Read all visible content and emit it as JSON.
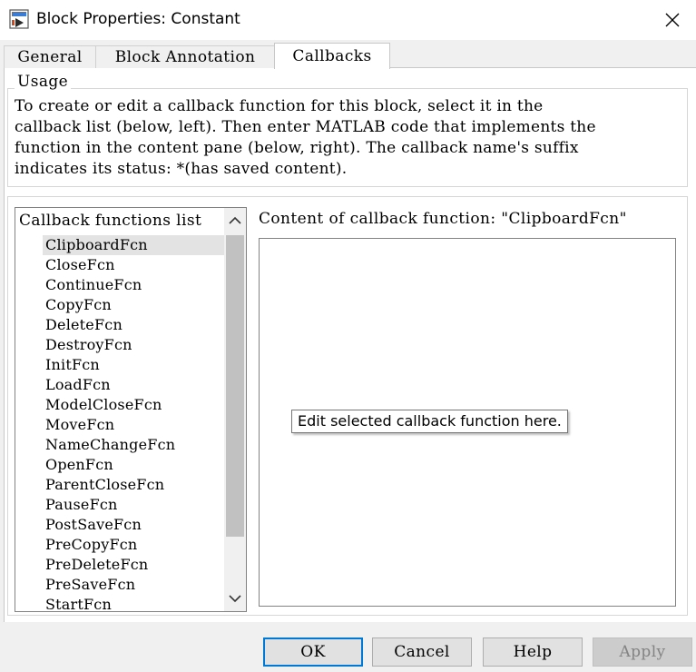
{
  "window": {
    "title": "Block Properties: Constant",
    "icon": "simulink-block-icon",
    "close_icon": "close-icon"
  },
  "tabs": [
    {
      "label": "General",
      "active": false
    },
    {
      "label": "Block Annotation",
      "active": false
    },
    {
      "label": "Callbacks",
      "active": true
    }
  ],
  "usage": {
    "legend": "Usage",
    "text": "To create or edit a callback function for this block, select it in the\ncallback list (below, left). Then enter MATLAB code that implements the\nfunction in the content pane (below, right). The callback name's suffix\nindicates its status: *(has saved content)."
  },
  "callbacks": {
    "header": "Callback functions list",
    "selected": "ClipboardFcn",
    "items": [
      "ClipboardFcn",
      "CloseFcn",
      "ContinueFcn",
      "CopyFcn",
      "DeleteFcn",
      "DestroyFcn",
      "InitFcn",
      "LoadFcn",
      "ModelCloseFcn",
      "MoveFcn",
      "NameChangeFcn",
      "OpenFcn",
      "ParentCloseFcn",
      "PauseFcn",
      "PostSaveFcn",
      "PreCopyFcn",
      "PreDeleteFcn",
      "PreSaveFcn",
      "StartFcn"
    ]
  },
  "content": {
    "label": "Content of callback function: \"ClipboardFcn\"",
    "tooltip": "Edit selected callback function here."
  },
  "buttons": {
    "ok": "OK",
    "cancel": "Cancel",
    "help": "Help",
    "apply": "Apply"
  },
  "colors": {
    "focus_border": "#0078d7",
    "disabled_text": "#838383"
  }
}
